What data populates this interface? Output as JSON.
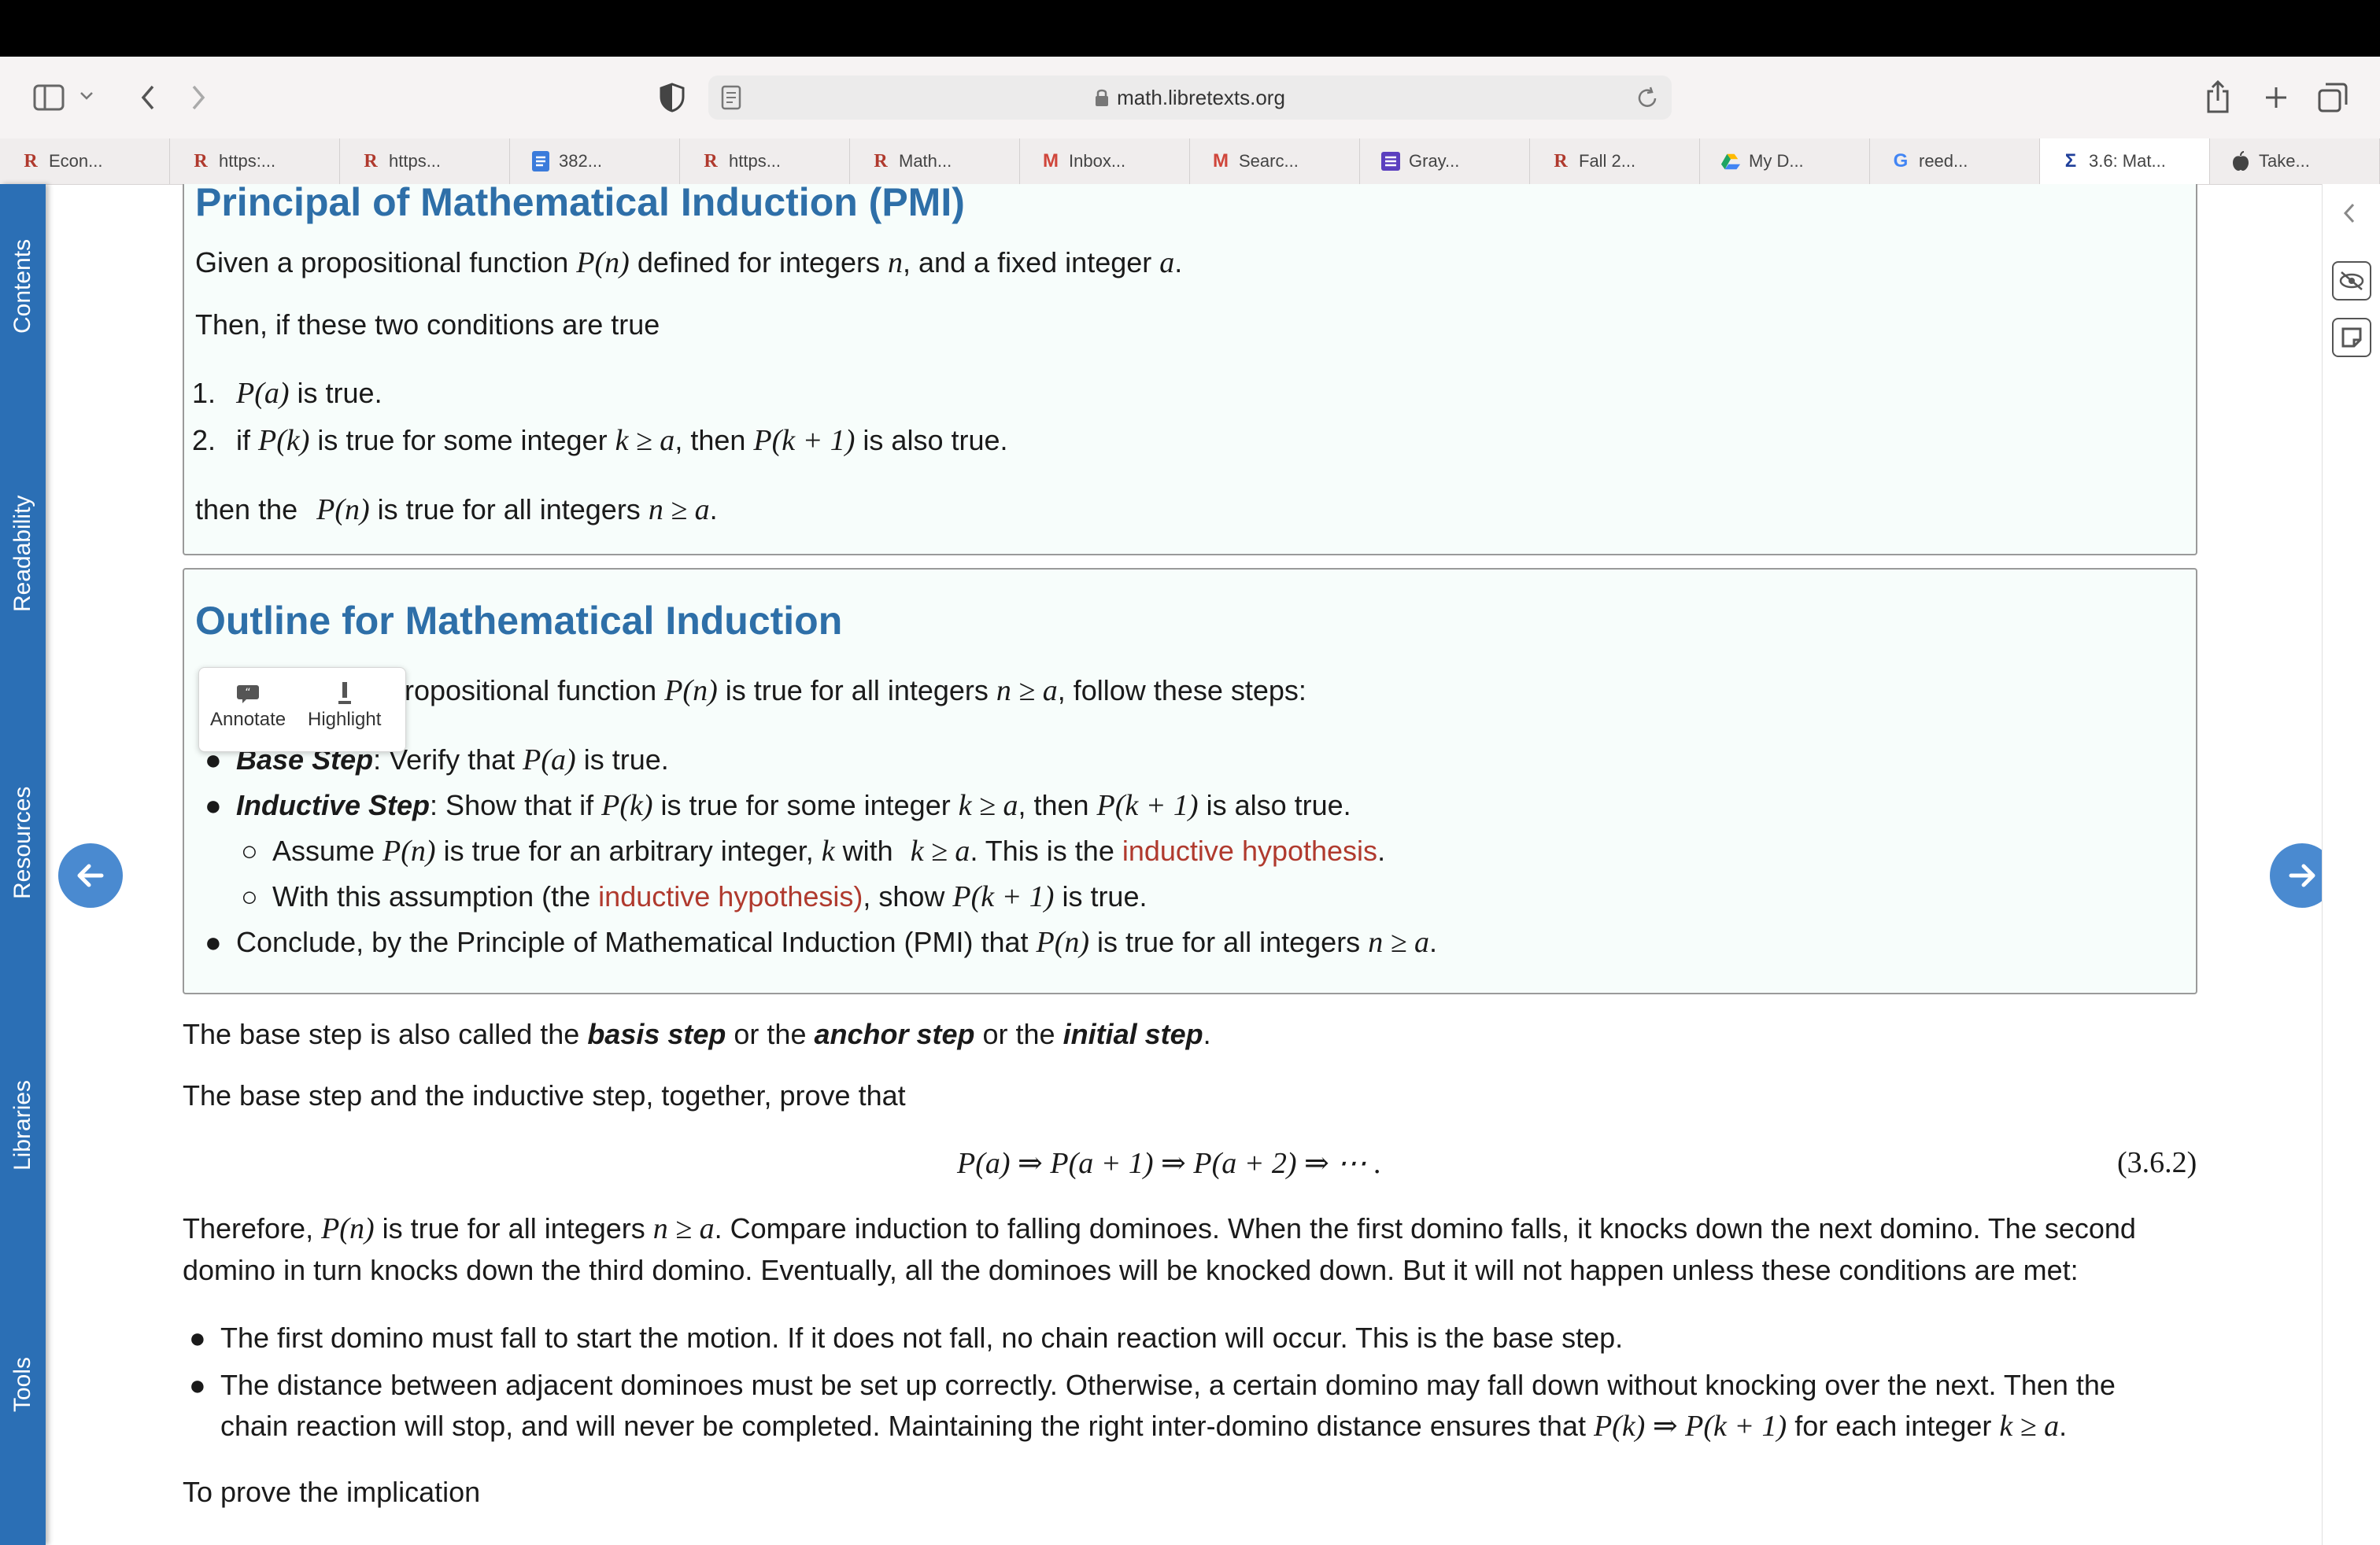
{
  "browser": {
    "url": "math.libretexts.org",
    "tabs": [
      {
        "icon": "R",
        "icon_color": "#b03a2e",
        "label": "Econ..."
      },
      {
        "icon": "R",
        "icon_color": "#b03a2e",
        "label": "https:..."
      },
      {
        "icon": "R",
        "icon_color": "#b03a2e",
        "label": "https..."
      },
      {
        "icon": "docs-icon",
        "icon_color": "#3a7bdb",
        "label": "382..."
      },
      {
        "icon": "R",
        "icon_color": "#b03a2e",
        "label": "https..."
      },
      {
        "icon": "R",
        "icon_color": "#b03a2e",
        "label": "Math..."
      },
      {
        "icon": "M",
        "icon_color": "#d0463b",
        "label": "Inbox..."
      },
      {
        "icon": "M",
        "icon_color": "#d0463b",
        "label": "Searc..."
      },
      {
        "icon": "list-icon",
        "icon_color": "#5b3fbf",
        "label": "Gray..."
      },
      {
        "icon": "R",
        "icon_color": "#b03a2e",
        "label": "Fall 2..."
      },
      {
        "icon": "drive-icon",
        "icon_color": "#1fa463",
        "label": "My D..."
      },
      {
        "icon": "G",
        "icon_color": "#4285f4",
        "label": "reed..."
      },
      {
        "icon": "Σ",
        "icon_color": "#1f3f9a",
        "label": "3.6: Mat...",
        "active": true
      },
      {
        "icon": "apple-icon",
        "icon_color": "#444444",
        "label": "Take..."
      }
    ]
  },
  "sidebar": {
    "items": [
      "Contents",
      "Readability",
      "Resources",
      "Libraries",
      "Tools"
    ]
  },
  "pmi_box": {
    "title": "Principal of Mathematical Induction (PMI)",
    "given_a": "Given a propositional function ",
    "given_b": " defined for integers ",
    "given_c": ", and a fixed integer ",
    "given_d": ".",
    "then_line": "Then, if these two conditions are true",
    "cond1_num": "1.",
    "cond1_text": " is true.",
    "cond2_num": "2.",
    "cond2_a": "if ",
    "cond2_b": " is true for some integer ",
    "cond2_c": ", then ",
    "cond2_d": " is also true.",
    "conclusion_a": "then the ",
    "conclusion_b": " is true for all integers ",
    "conclusion_c": "."
  },
  "outline_box": {
    "title": "Outline for Mathematical Induction",
    "intro_visible": "ropositional function ",
    "intro_b": " is true for all integers ",
    "intro_c": ", follow these steps:",
    "base_step_label": "Base Step",
    "base_step_a": ": Verify that ",
    "base_step_b": " is true.",
    "inductive_label": "Inductive Step",
    "inductive_a": ": Show that if ",
    "inductive_b": " is true for some integer ",
    "inductive_c": ", then ",
    "inductive_d": " is also true.",
    "sub1_a": "Assume ",
    "sub1_b": " is true for an arbitrary integer, ",
    "sub1_c": " with ",
    "sub1_d": ".  This is the ",
    "sub1_link": "inductive hypothesis",
    "sub1_e": ".",
    "sub2_a": "With this assumption (the ",
    "sub2_link": "inductive hypothesis)",
    "sub2_b": ", show ",
    "sub2_c": " is true.",
    "conclude_a": "Conclude, by the Principle of Mathematical Induction (PMI) that ",
    "conclude_b": " is true for all integers ",
    "conclude_c": "."
  },
  "popup": {
    "annotate": "Annotate",
    "highlight": "Highlight"
  },
  "body": {
    "p1_a": "The base step is also called the ",
    "p1_b1": "basis step",
    "p1_c": " or the ",
    "p1_b2": "anchor step",
    "p1_d": " or the ",
    "p1_b3": "initial step",
    "p1_e": ".",
    "p2": "The base step and the inductive step, together, prove that",
    "eq_num": "(3.6.2)",
    "p3_a": "Therefore, ",
    "p3_b": " is true for all integers ",
    "p3_c": ". Compare induction to falling dominoes. When the first domino falls, it knocks down the next domino. The second",
    "p3_line2": "domino in turn knocks down the third domino. Eventually, all the dominoes will be knocked down. But it will not happen unless these conditions are met:",
    "li1": "The first domino must fall to start the motion. If it does not fall, no chain reaction will occur. This is the base step.",
    "li2_line1": "The distance between adjacent dominoes must be set up correctly. Otherwise, a certain domino may fall down without knocking over the next. Then the",
    "li2_line2_a": "chain reaction will stop, and will never be completed. Maintaining the right inter-domino distance ensures that ",
    "li2_line2_b": " for each integer ",
    "li2_line2_c": ".",
    "p4": "To prove the implication"
  },
  "math": {
    "Pn": "P(n)",
    "n": "n",
    "a": "a",
    "Pa": "P(a)",
    "Pk": "P(k)",
    "k_ge_a": "k ≥ a",
    "Pk1": "P(k + 1)",
    "n_ge_a": "n ≥ a",
    "k": "k",
    "chain": "P(a) ⇒ P(a + 1) ⇒ P(a + 2) ⇒ ⋯ .",
    "implies": "P(k) ⇒ P(k + 1)"
  },
  "colors": {
    "accent": "#2e6fa8",
    "link_red": "#b03a2e",
    "sidebar_blue": "#2b6fb5"
  }
}
